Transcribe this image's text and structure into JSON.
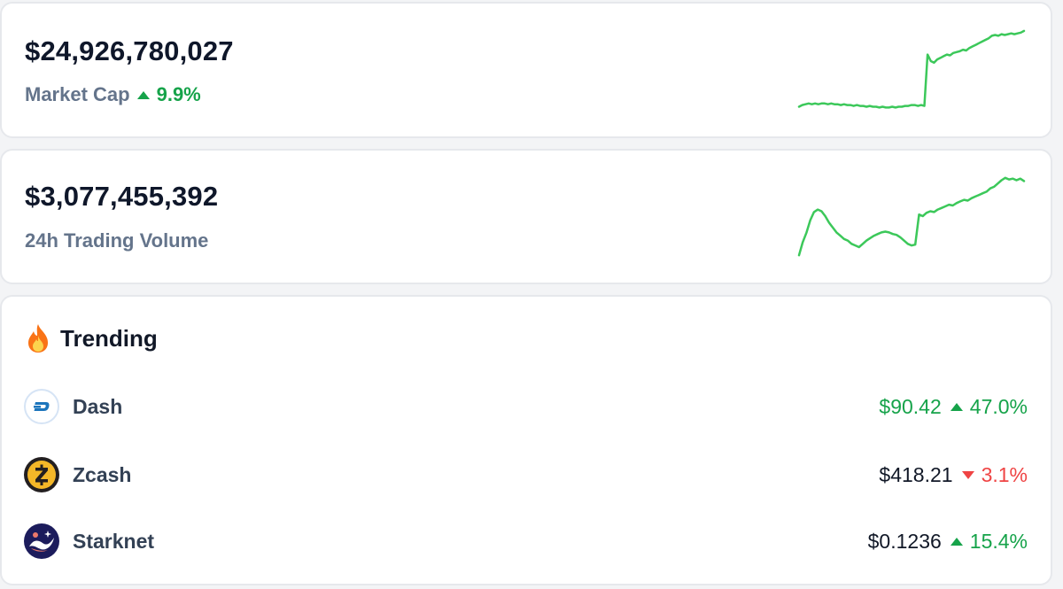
{
  "market_cap": {
    "value": "$24,926,780,027",
    "label": "Market Cap",
    "change": "9.9%",
    "direction": "up",
    "sparkline": [
      0.06,
      0.08,
      0.09,
      0.1,
      0.09,
      0.1,
      0.09,
      0.1,
      0.1,
      0.09,
      0.1,
      0.09,
      0.09,
      0.08,
      0.09,
      0.08,
      0.08,
      0.07,
      0.08,
      0.07,
      0.07,
      0.06,
      0.07,
      0.06,
      0.06,
      0.05,
      0.06,
      0.05,
      0.05,
      0.06,
      0.05,
      0.06,
      0.06,
      0.07,
      0.07,
      0.08,
      0.08,
      0.07,
      0.08,
      0.07,
      0.7,
      0.62,
      0.6,
      0.64,
      0.66,
      0.68,
      0.7,
      0.69,
      0.72,
      0.73,
      0.74,
      0.76,
      0.75,
      0.78,
      0.8,
      0.82,
      0.84,
      0.86,
      0.88,
      0.9,
      0.93,
      0.94,
      0.93,
      0.95,
      0.94,
      0.95,
      0.96,
      0.95,
      0.96,
      0.97,
      0.99
    ]
  },
  "volume": {
    "value": "$3,077,455,392",
    "label": "24h Trading Volume",
    "sparkline": [
      0.02,
      0.18,
      0.3,
      0.45,
      0.55,
      0.58,
      0.56,
      0.5,
      0.42,
      0.36,
      0.3,
      0.26,
      0.22,
      0.2,
      0.16,
      0.14,
      0.12,
      0.16,
      0.2,
      0.23,
      0.26,
      0.28,
      0.3,
      0.31,
      0.3,
      0.28,
      0.27,
      0.24,
      0.2,
      0.16,
      0.14,
      0.15,
      0.52,
      0.5,
      0.54,
      0.56,
      0.55,
      0.58,
      0.6,
      0.62,
      0.64,
      0.63,
      0.66,
      0.68,
      0.7,
      0.69,
      0.72,
      0.74,
      0.76,
      0.78,
      0.8,
      0.84,
      0.86,
      0.9,
      0.94,
      0.97,
      0.95,
      0.96,
      0.94,
      0.96,
      0.93
    ]
  },
  "trending": {
    "title": "Trending",
    "items": [
      {
        "name": "Dash",
        "price": "$90.42",
        "change": "47.0%",
        "direction": "up",
        "price_green": true,
        "icon": "dash-icon"
      },
      {
        "name": "Zcash",
        "price": "$418.21",
        "change": "3.1%",
        "direction": "down",
        "price_green": false,
        "icon": "zcash-icon"
      },
      {
        "name": "Starknet",
        "price": "$0.1236",
        "change": "15.4%",
        "direction": "up",
        "price_green": false,
        "icon": "starknet-icon"
      }
    ]
  },
  "colors": {
    "up": "#16a34a",
    "down": "#ef4444",
    "sparkline": "#3cc85a"
  }
}
